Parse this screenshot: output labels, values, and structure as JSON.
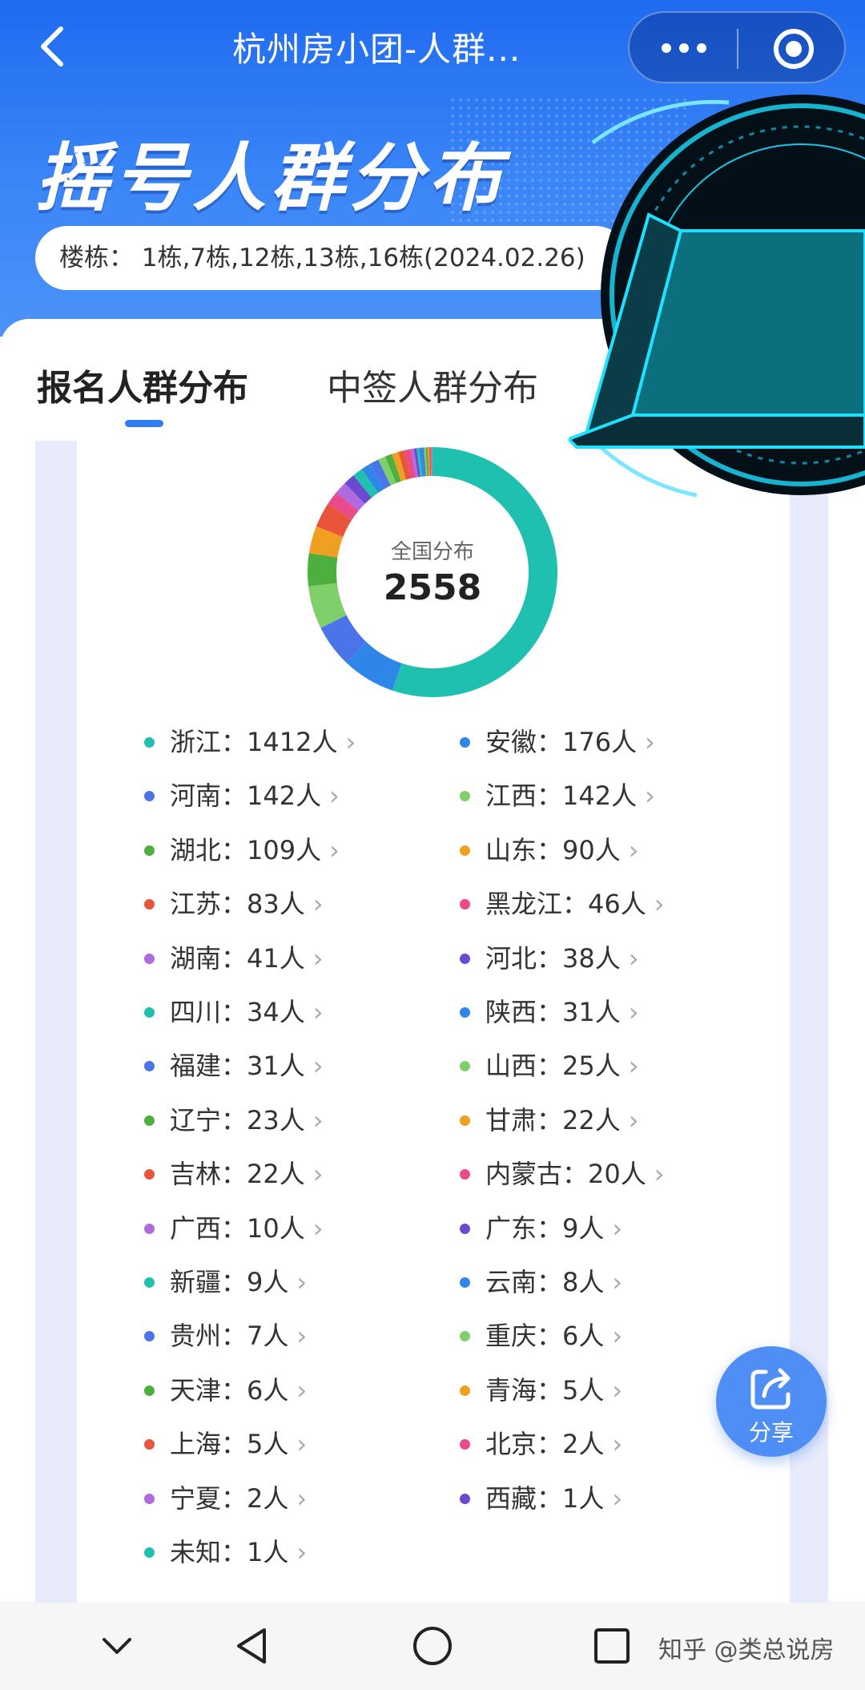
{
  "nav": {
    "title": "杭州房小团-人群..."
  },
  "banner": {
    "title": "摇号人群分布",
    "filter_text": "楼栋：  1栋,7栋,12栋,13栋,16栋(2024.02.26)"
  },
  "tabs": [
    {
      "label": "报名人群分布",
      "active": true
    },
    {
      "label": "中签人群分布",
      "active": false
    }
  ],
  "summary": {
    "label": "全国分布",
    "total": "2558"
  },
  "colors": {
    "primary": "#2f7cf5",
    "palette": [
      "#1fc0b0",
      "#2e86e8",
      "#4a74e8",
      "#7fcf6a",
      "#4caf3e",
      "#f0a020",
      "#e8553a",
      "#e84a8a",
      "#b06ae0",
      "#6a4ad0"
    ]
  },
  "chart_data": {
    "type": "pie",
    "title": "全国分布",
    "total": 2558,
    "unit": "人",
    "categories": [
      "浙江",
      "安徽",
      "河南",
      "江西",
      "湖北",
      "山东",
      "江苏",
      "黑龙江",
      "湖南",
      "河北",
      "四川",
      "陕西",
      "福建",
      "山西",
      "辽宁",
      "甘肃",
      "吉林",
      "内蒙古",
      "广西",
      "广东",
      "新疆",
      "云南",
      "贵州",
      "重庆",
      "天津",
      "青海",
      "上海",
      "北京",
      "宁夏",
      "西藏",
      "未知"
    ],
    "values": [
      1412,
      176,
      142,
      142,
      109,
      90,
      83,
      46,
      41,
      38,
      34,
      31,
      31,
      25,
      23,
      22,
      22,
      20,
      10,
      9,
      9,
      8,
      7,
      6,
      6,
      5,
      5,
      2,
      2,
      1,
      1
    ]
  },
  "legend": [
    {
      "text": "浙江：1412人",
      "chev": "›"
    },
    {
      "text": "安徽：176人",
      "chev": "›"
    },
    {
      "text": "河南：142人",
      "chev": "›"
    },
    {
      "text": "江西：142人",
      "chev": "›"
    },
    {
      "text": "湖北：109人",
      "chev": "›"
    },
    {
      "text": "山东：90人",
      "chev": "›"
    },
    {
      "text": "江苏：83人",
      "chev": "›"
    },
    {
      "text": "黑龙江：46人",
      "chev": "›"
    },
    {
      "text": "湖南：41人",
      "chev": "›"
    },
    {
      "text": "河北：38人",
      "chev": "›"
    },
    {
      "text": "四川：34人",
      "chev": "›"
    },
    {
      "text": "陕西：31人",
      "chev": "›"
    },
    {
      "text": "福建：31人",
      "chev": "›"
    },
    {
      "text": "山西：25人",
      "chev": "›"
    },
    {
      "text": "辽宁：23人",
      "chev": "›"
    },
    {
      "text": "甘肃：22人",
      "chev": "›"
    },
    {
      "text": "吉林：22人",
      "chev": "›"
    },
    {
      "text": "内蒙古：20人",
      "chev": "›"
    },
    {
      "text": "广西：10人",
      "chev": "›"
    },
    {
      "text": "广东：9人",
      "chev": "›"
    },
    {
      "text": "新疆：9人",
      "chev": "›"
    },
    {
      "text": "云南：8人",
      "chev": "›"
    },
    {
      "text": "贵州：7人",
      "chev": "›"
    },
    {
      "text": "重庆：6人",
      "chev": "›"
    },
    {
      "text": "天津：6人",
      "chev": "›"
    },
    {
      "text": "青海：5人",
      "chev": "›"
    },
    {
      "text": "上海：5人",
      "chev": "›"
    },
    {
      "text": "北京：2人",
      "chev": "›"
    },
    {
      "text": "宁夏：2人",
      "chev": "›"
    },
    {
      "text": "西藏：1人",
      "chev": "›"
    },
    {
      "text": "未知：1人",
      "chev": "›"
    }
  ],
  "share": {
    "label": "分享",
    "icon": "share-icon"
  },
  "system_nav": {
    "icons": [
      "chevron-down-icon",
      "back-triangle-icon",
      "home-circle-icon",
      "recents-square-icon"
    ],
    "watermark": "知乎 @类总说房"
  }
}
